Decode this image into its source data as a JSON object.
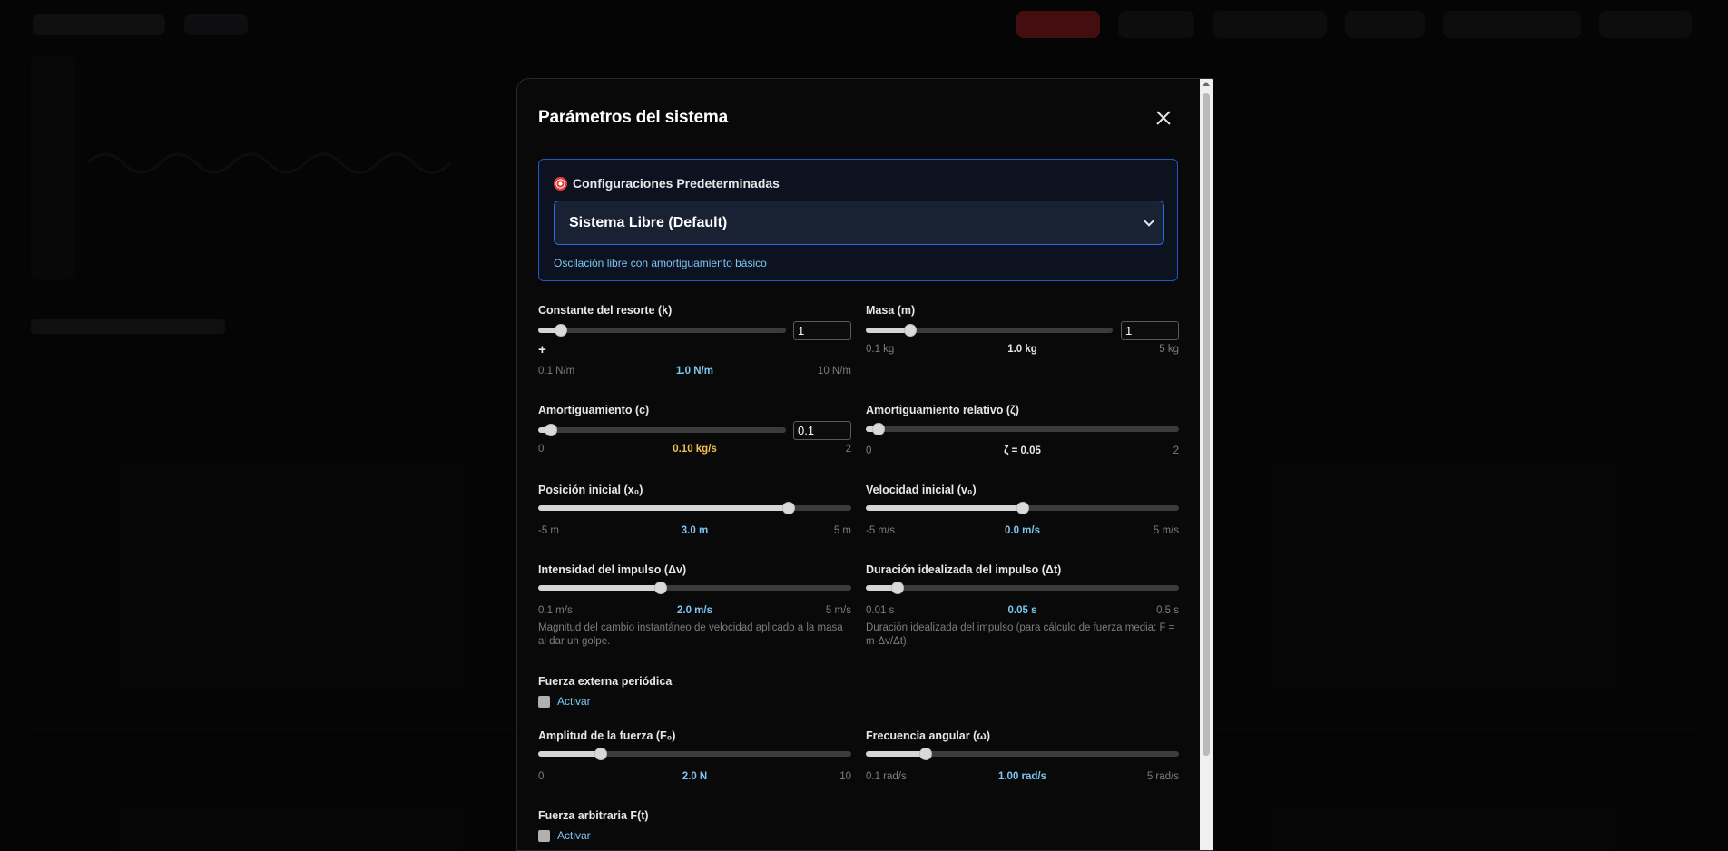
{
  "modal": {
    "title": "Parámetros del sistema",
    "close_icon": "close-icon"
  },
  "presets": {
    "title": "Configuraciones Predeterminadas",
    "icon": "target-icon",
    "selected": "Sistema Libre (Default)",
    "description": "Oscilación libre con amortiguamiento básico"
  },
  "fields": {
    "k": {
      "label": "Constante del resorte (k)",
      "input": "1",
      "min": "0.1 N/m",
      "max": "10 N/m",
      "value": "1.0 N/m",
      "plus": "+",
      "fraction": 0.09
    },
    "m": {
      "label": "Masa (m)",
      "input": "1",
      "min": "0.1 kg",
      "max": "5 kg",
      "value": "1.0 kg",
      "fraction": 0.18
    },
    "c": {
      "label": "Amortiguamiento (c)",
      "input": "0.1",
      "min": "0",
      "max": "2",
      "value": "0.10 kg/s",
      "fraction": 0.05
    },
    "zeta": {
      "label": "Amortiguamiento relativo (ζ)",
      "min": "0",
      "max": "2",
      "value": "ζ = 0.05",
      "fraction": 0.04
    },
    "x0": {
      "label": "Posición inicial (x₀)",
      "min": "-5 m",
      "max": "5 m",
      "value": "3.0 m",
      "fraction": 0.8
    },
    "v0": {
      "label": "Velocidad inicial (v₀)",
      "min": "-5 m/s",
      "max": "5 m/s",
      "value": "0.0 m/s",
      "fraction": 0.5
    },
    "dv": {
      "label": "Intensidad del impulso (Δv)",
      "min": "0.1 m/s",
      "max": "5 m/s",
      "value": "2.0 m/s",
      "fraction": 0.39,
      "help": "Magnitud del cambio instantáneo de velocidad aplicado a la masa al dar un golpe."
    },
    "dt": {
      "label": "Duración idealizada del impulso (Δt)",
      "min": "0.01 s",
      "max": "0.5 s",
      "value": "0.05 s",
      "fraction": 0.1,
      "help": "Duración idealizada del impulso (para cálculo de fuerza media: F = m·Δv/Δt)."
    },
    "periodic": {
      "label": "Fuerza externa periódica",
      "checkbox": "Activar"
    },
    "f0": {
      "label": "Amplitud de la fuerza (F₀)",
      "min": "0",
      "max": "10",
      "value": "2.0 N",
      "fraction": 0.2
    },
    "omega": {
      "label": "Frecuencia angular (ω)",
      "min": "0.1 rad/s",
      "max": "5 rad/s",
      "value": "1.00 rad/s",
      "fraction": 0.19
    },
    "arbitrary": {
      "label": "Fuerza arbitraria F(t)",
      "checkbox": "Activar"
    }
  }
}
